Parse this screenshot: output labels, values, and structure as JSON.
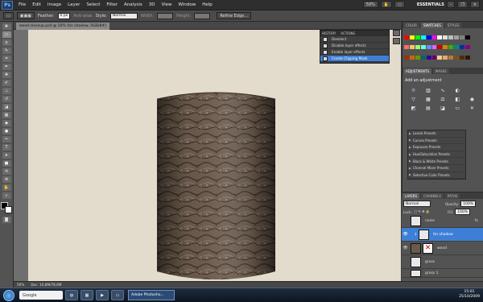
{
  "menubar": {
    "logo": "Ps",
    "items": [
      "File",
      "Edit",
      "Image",
      "Layer",
      "Select",
      "Filter",
      "Analysis",
      "3D",
      "View",
      "Window",
      "Help"
    ],
    "zoom": "50%",
    "workspace": "ESSENTIALS"
  },
  "options": {
    "feather_label": "Feather:",
    "feather_value": "0 px",
    "antialias": "Anti-alias",
    "style_label": "Style:",
    "style_value": "Normal",
    "width_label": "Width:",
    "height_label": "Height:",
    "refine": "Refine Edge..."
  },
  "document": {
    "tab": "wood-closeup.psd @ 50% (tin shadow, RGB/8#)"
  },
  "history": {
    "tabs": [
      "HISTORY",
      "ACTIONS"
    ],
    "items": [
      "Deselect",
      "Disable layer effects",
      "Enable layer effects",
      "Create Clipping Mask"
    ]
  },
  "color_panel": {
    "tabs": [
      "COLOR",
      "SWATCHES",
      "STYLES"
    ],
    "swatches": [
      "#ff0000",
      "#ffff00",
      "#00ff00",
      "#00ffff",
      "#0000ff",
      "#ff00ff",
      "#ffffff",
      "#e0e0e0",
      "#c0c0c0",
      "#a0a0a0",
      "#808080",
      "#000000",
      "#ff6a6a",
      "#ffc36a",
      "#9fff6a",
      "#6affd9",
      "#6a8dff",
      "#d96aff",
      "#cc0000",
      "#cc8800",
      "#44aa00",
      "#008888",
      "#003399",
      "#880088",
      "#993300",
      "#cc6600",
      "#669900",
      "#006666",
      "#330099",
      "#660066",
      "#f4c99b",
      "#e8a86a",
      "#b57a3e",
      "#7a4f26",
      "#4a2e14",
      "#2a1a0a"
    ]
  },
  "adjustments": {
    "tabs": [
      "ADJUSTMENTS",
      "MASKS"
    ],
    "title": "Add an adjustment",
    "presets": [
      "Levels Presets",
      "Curves Presets",
      "Exposure Presets",
      "Hue/Saturation Presets",
      "Black & White Presets",
      "Channel Mixer Presets",
      "Selective Color Presets"
    ]
  },
  "layers": {
    "tabs": [
      "LAYERS",
      "CHANNELS",
      "PATHS"
    ],
    "blend": "Normal",
    "opacity_label": "Opacity:",
    "opacity": "100%",
    "lock_label": "Lock:",
    "fill_label": "Fill:",
    "fill": "100%",
    "items": [
      {
        "name": "noise",
        "fx": "fx"
      },
      {
        "name": "tin shadow",
        "fx": ""
      },
      {
        "name": "wood",
        "fx": ""
      },
      {
        "name": "grass",
        "fx": ""
      },
      {
        "name": "grass 1",
        "fx": ""
      }
    ]
  },
  "status": {
    "zoom": "50%",
    "doc": "Doc: 10,8M/78,6M"
  },
  "taskbar": {
    "search": "Google",
    "app": "Adobe Photosho...",
    "time": "15:01",
    "date": "25/10/2009"
  }
}
